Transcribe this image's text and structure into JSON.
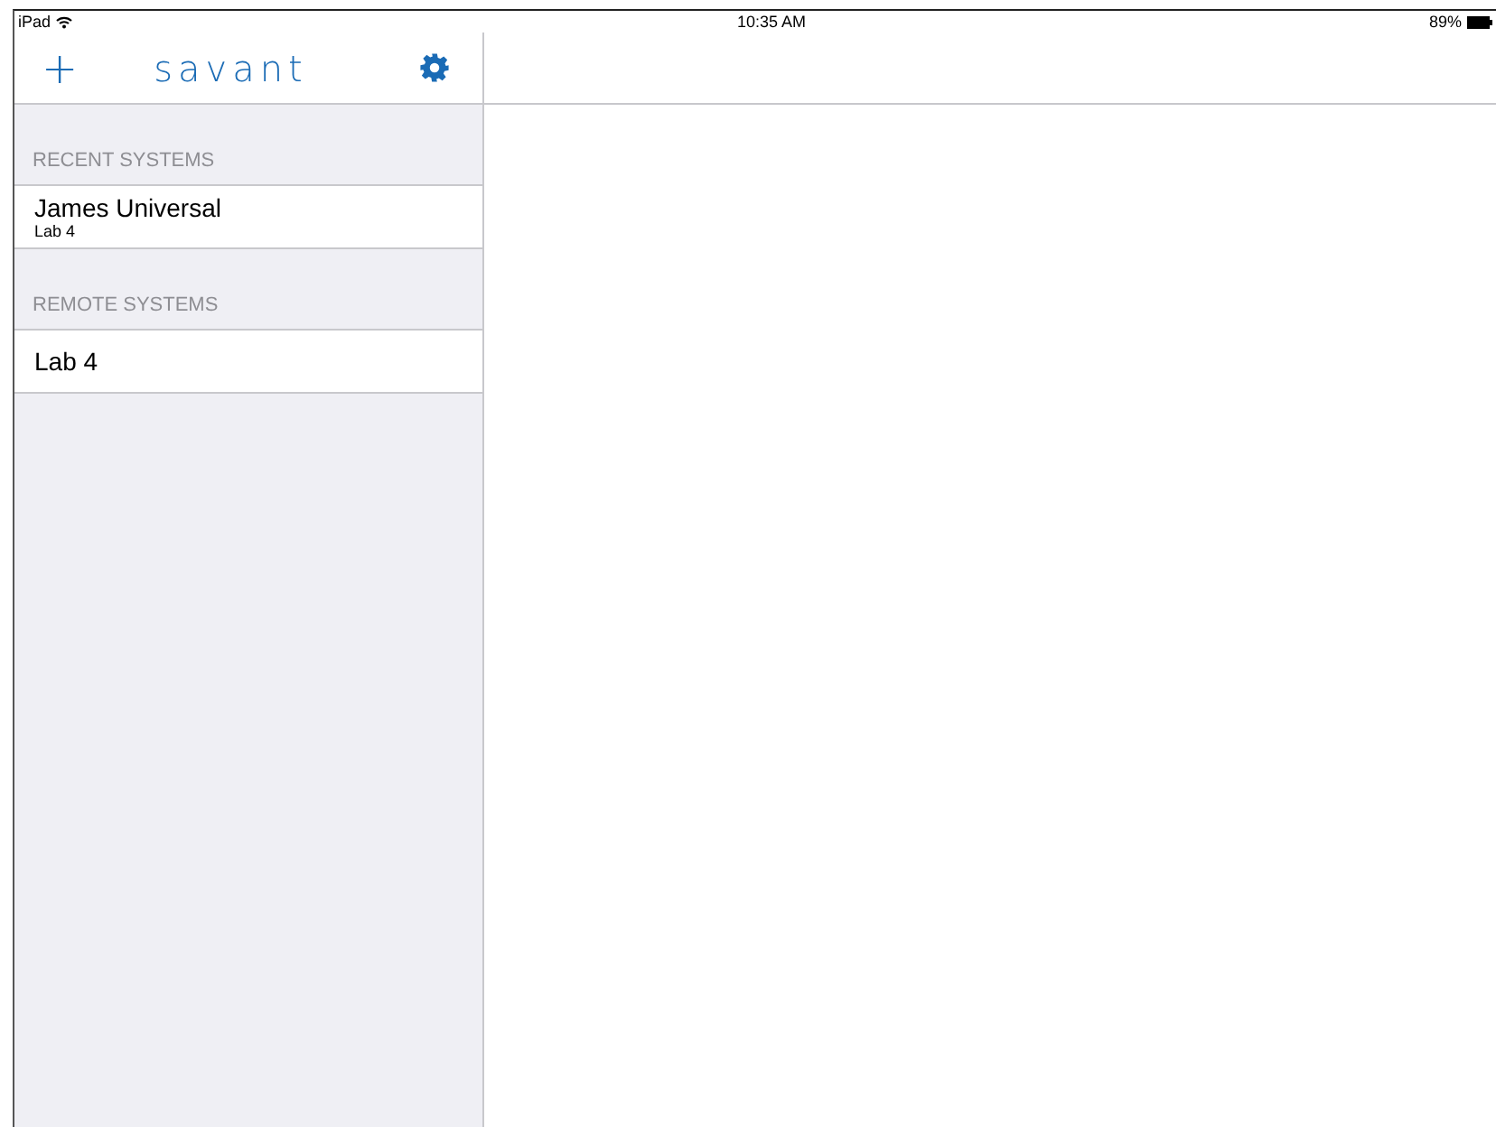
{
  "status_bar": {
    "device": "iPad",
    "time": "10:35 AM",
    "battery": "89%"
  },
  "nav": {
    "add": "+",
    "logo": "savant"
  },
  "sections": [
    {
      "header": "RECENT SYSTEMS",
      "items": [
        {
          "title": "James Universal",
          "subtitle": "Lab 4"
        }
      ]
    },
    {
      "header": "REMOTE SYSTEMS",
      "items": [
        {
          "title": "Lab 4"
        }
      ]
    }
  ]
}
